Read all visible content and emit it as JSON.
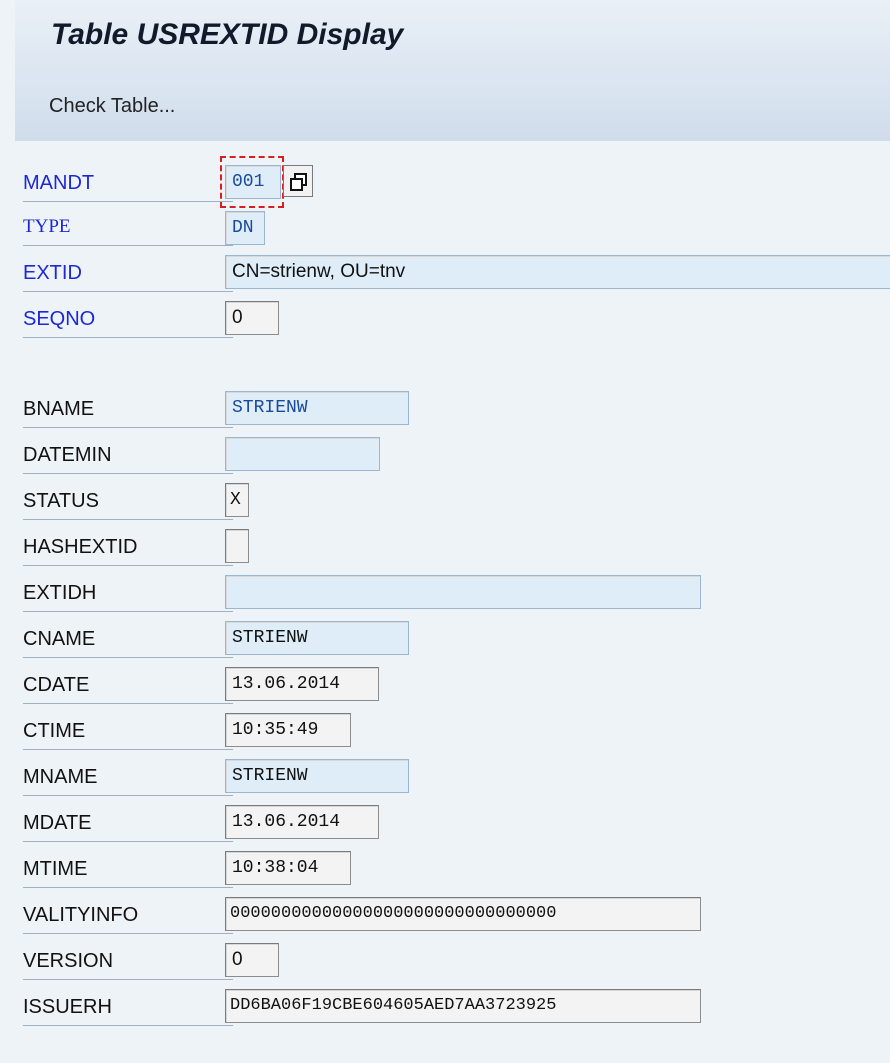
{
  "header": {
    "title": "Table USREXTID Display"
  },
  "toolbar": {
    "check_table_label": "Check Table..."
  },
  "fields": {
    "mandt": {
      "label": "MANDT",
      "value": "001"
    },
    "type": {
      "label": "TYPE",
      "value": "DN"
    },
    "extid": {
      "label": "EXTID",
      "value": "CN=strienw, OU=tnv"
    },
    "seqno": {
      "label": "SEQNO",
      "value": "0"
    },
    "bname": {
      "label": "BNAME",
      "value": "STRIENW"
    },
    "datemin": {
      "label": "DATEMIN",
      "value": ""
    },
    "status": {
      "label": "STATUS",
      "value": "X"
    },
    "hashextid": {
      "label": "HASHEXTID",
      "value": ""
    },
    "extidh": {
      "label": "EXTIDH",
      "value": ""
    },
    "cname": {
      "label": "CNAME",
      "value": "STRIENW"
    },
    "cdate": {
      "label": "CDATE",
      "value": "13.06.2014"
    },
    "ctime": {
      "label": "CTIME",
      "value": "10:35:49"
    },
    "mname": {
      "label": "MNAME",
      "value": "STRIENW"
    },
    "mdate": {
      "label": "MDATE",
      "value": "13.06.2014"
    },
    "mtime": {
      "label": "MTIME",
      "value": "10:38:04"
    },
    "validityinfo": {
      "label": "VALITYINFO",
      "value": "00000000000000000000000000000000"
    },
    "version": {
      "label": "VERSION",
      "value": "0"
    },
    "issuerh": {
      "label": "ISSUERH",
      "value": "DD6BA06F19CBE604605AED7AA3723925"
    }
  },
  "icons": {
    "copy": "copy-icon"
  },
  "colors": {
    "key_label": "#1d27d6",
    "field_blue": "#deedf8",
    "focus": "#d81f1f"
  }
}
